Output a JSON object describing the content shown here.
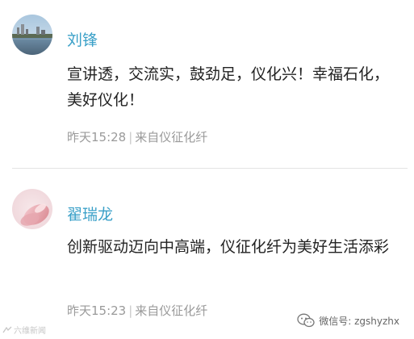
{
  "comments": [
    {
      "name": "刘锋",
      "text": "宣讲透，交流实，鼓劲足，仪化兴！幸福石化，美好仪化！",
      "time": "昨天15:28",
      "source": "来自仪征化纤"
    },
    {
      "name": "翟瑞龙",
      "text": "创新驱动迈向中高端，仪征化纤为美好生活添彩",
      "time": "昨天15:23",
      "source": "来自仪征化纤"
    }
  ],
  "separator": "|",
  "watermark": {
    "left": "六维新闻",
    "right": "微信号: zgshyzhx"
  },
  "colors": {
    "name": "#3aa0c8",
    "text": "#222222",
    "meta": "#9a9a9a"
  }
}
